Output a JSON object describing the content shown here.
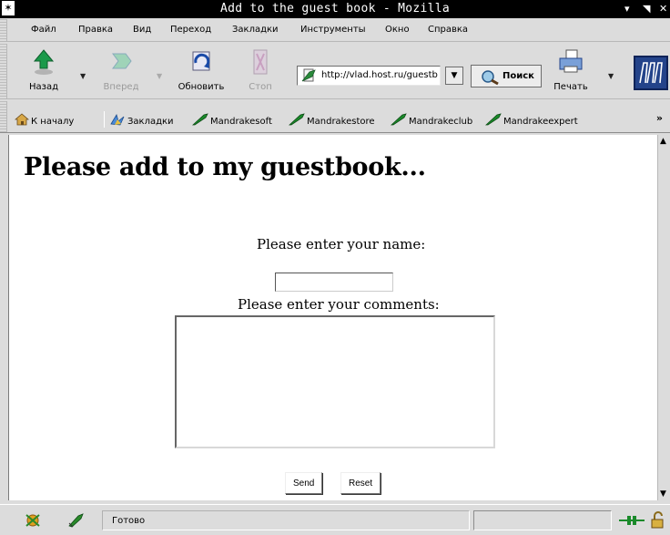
{
  "window": {
    "title": "Add to the guest book - Mozilla",
    "pin_glyph": "✶",
    "controls": [
      "▾",
      "◥",
      "✕"
    ]
  },
  "menu": {
    "items": [
      {
        "label": "Файл"
      },
      {
        "label": "Правка"
      },
      {
        "label": "Вид"
      },
      {
        "label": "Переход"
      },
      {
        "label": "Закладки"
      },
      {
        "label": "Инструменты"
      },
      {
        "label": "Окно"
      },
      {
        "label": "Справка"
      }
    ]
  },
  "toolbar": {
    "back_label": "Назад",
    "forward_label": "Вперед",
    "reload_label": "Обновить",
    "stop_label": "Стоп",
    "url": "http://vlad.host.ru/guestbook",
    "search_label": "Поиск",
    "print_label": "Печать",
    "dropdown_glyph": "▼"
  },
  "personal_toolbar": {
    "home_label": "К началу",
    "bookmarks_label": "Закладки",
    "links": [
      "Mandrakesoft",
      "Mandrakestore",
      "Mandrakeclub",
      "Mandrakeexpert"
    ],
    "more_glyph": "»"
  },
  "page": {
    "heading": "Please add to my guestbook...",
    "name_label": "Please enter your name:",
    "name_value": "",
    "comments_label": "Please enter your comments:",
    "comments_value": "",
    "send_label": "Send",
    "reset_label": "Reset"
  },
  "scrollbar": {
    "up_glyph": "▲",
    "down_glyph": "▼"
  },
  "status": {
    "text": "Готово"
  },
  "colors": {
    "chrome": "#dcdcdc",
    "titlebar": "#000000",
    "mandrake_logo": "#23438a",
    "bookmark_icon": "#1a8a2a"
  },
  "icons": {
    "back": "back-arrow-icon",
    "forward": "forward-arrow-icon",
    "reload": "reload-icon",
    "stop": "stop-icon",
    "page": "page-proxy-icon",
    "search": "search-icon",
    "print": "printer-icon",
    "logo": "mozilla-m-logo-icon",
    "home": "home-icon",
    "bookmarks": "bookmarks-icon",
    "link": "bookmark-link-icon",
    "security": "padlock-icon",
    "online": "online-plug-icon"
  }
}
